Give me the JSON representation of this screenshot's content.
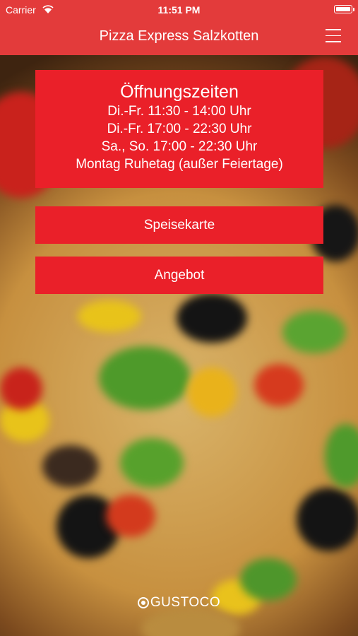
{
  "status_bar": {
    "carrier": "Carrier",
    "time": "11:51 PM"
  },
  "nav": {
    "title": "Pizza Express Salzkotten",
    "menu_icon": "hamburger-menu-icon"
  },
  "opening_hours": {
    "title": "Öffnungszeiten",
    "lines": [
      "Di.-Fr. 11:30 - 14:00 Uhr",
      "Di.-Fr. 17:00 - 22:30 Uhr",
      "Sa., So. 17:00 - 22:30 Uhr",
      "Montag Ruhetag (außer Feiertage)"
    ]
  },
  "buttons": {
    "menu_label": "Speisekarte",
    "offer_label": "Angebot"
  },
  "footer": {
    "brand": "GUSTOCO"
  },
  "colors": {
    "nav_red": "#e33b3b",
    "card_red": "#ea2029",
    "text": "#ffffff"
  }
}
